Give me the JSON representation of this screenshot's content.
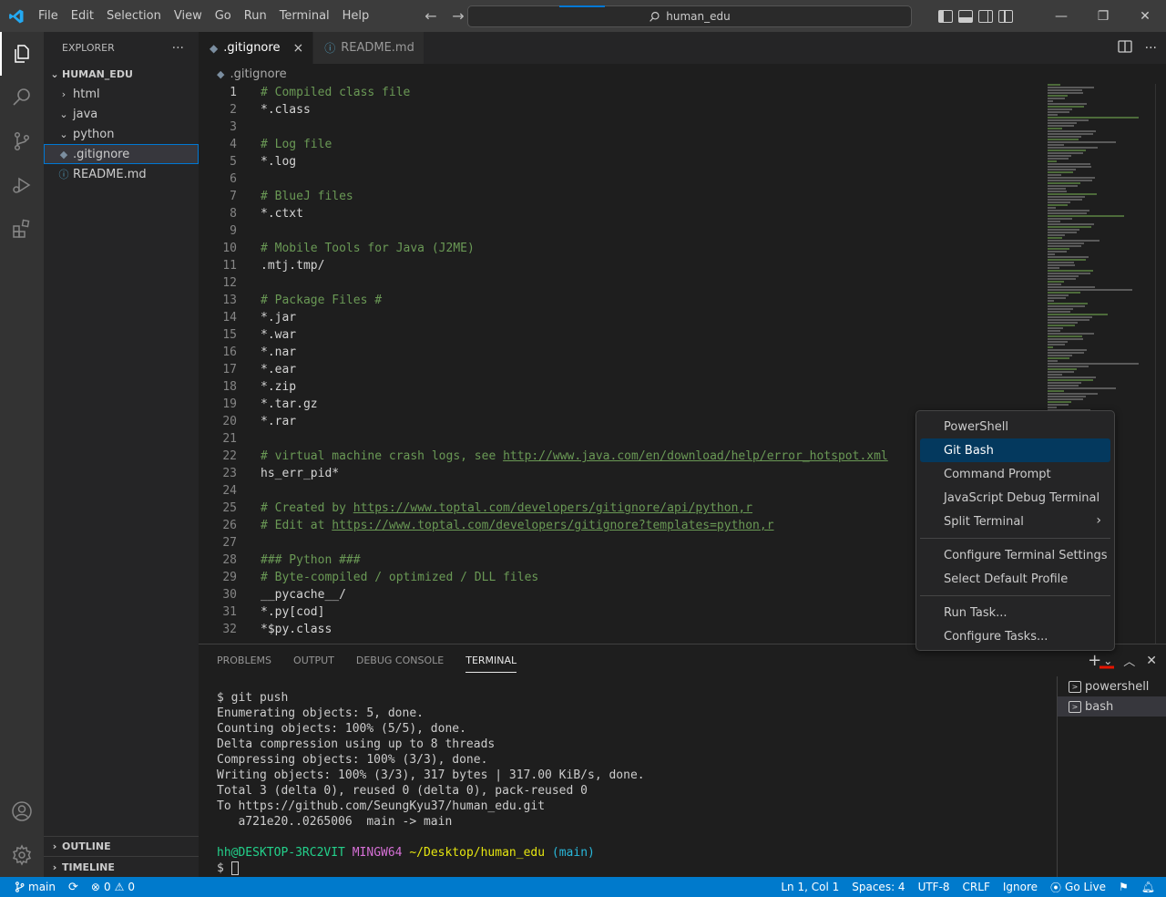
{
  "menu": [
    "File",
    "Edit",
    "Selection",
    "View",
    "Go",
    "Run",
    "Terminal",
    "Help"
  ],
  "command_center": {
    "label": "human_edu"
  },
  "sidebar": {
    "title": "EXPLORER",
    "more": "···",
    "root": "HUMAN_EDU",
    "items": [
      {
        "label": "html",
        "type": "folder",
        "expanded": false
      },
      {
        "label": "java",
        "type": "folder",
        "expanded": true
      },
      {
        "label": "python",
        "type": "folder",
        "expanded": true
      },
      {
        "label": ".gitignore",
        "type": "file",
        "selected": true
      },
      {
        "label": "README.md",
        "type": "file-info"
      }
    ],
    "outline": "OUTLINE",
    "timeline": "TIMELINE"
  },
  "tabs": [
    {
      "label": ".gitignore",
      "active": true,
      "close": "×"
    },
    {
      "label": "README.md",
      "active": false
    }
  ],
  "breadcrumb": ".gitignore",
  "code_lines": [
    {
      "n": "1",
      "text": "# Compiled class file",
      "kind": "comment"
    },
    {
      "n": "2",
      "text": "*.class",
      "kind": "plain"
    },
    {
      "n": "3",
      "text": "",
      "kind": "plain"
    },
    {
      "n": "4",
      "text": "# Log file",
      "kind": "comment"
    },
    {
      "n": "5",
      "text": "*.log",
      "kind": "plain"
    },
    {
      "n": "6",
      "text": "",
      "kind": "plain"
    },
    {
      "n": "7",
      "text": "# BlueJ files",
      "kind": "comment"
    },
    {
      "n": "8",
      "text": "*.ctxt",
      "kind": "plain"
    },
    {
      "n": "9",
      "text": "",
      "kind": "plain"
    },
    {
      "n": "10",
      "text": "# Mobile Tools for Java (J2ME)",
      "kind": "comment"
    },
    {
      "n": "11",
      "text": ".mtj.tmp/",
      "kind": "plain"
    },
    {
      "n": "12",
      "text": "",
      "kind": "plain"
    },
    {
      "n": "13",
      "text": "# Package Files #",
      "kind": "comment"
    },
    {
      "n": "14",
      "text": "*.jar",
      "kind": "plain"
    },
    {
      "n": "15",
      "text": "*.war",
      "kind": "plain"
    },
    {
      "n": "16",
      "text": "*.nar",
      "kind": "plain"
    },
    {
      "n": "17",
      "text": "*.ear",
      "kind": "plain"
    },
    {
      "n": "18",
      "text": "*.zip",
      "kind": "plain"
    },
    {
      "n": "19",
      "text": "*.tar.gz",
      "kind": "plain"
    },
    {
      "n": "20",
      "text": "*.rar",
      "kind": "plain"
    },
    {
      "n": "21",
      "text": "",
      "kind": "plain"
    },
    {
      "n": "22",
      "text": "# virtual machine crash logs, see ",
      "kind": "comment",
      "link": "http://www.java.com/en/download/help/error_hotspot.xml"
    },
    {
      "n": "23",
      "text": "hs_err_pid*",
      "kind": "plain"
    },
    {
      "n": "24",
      "text": "",
      "kind": "plain"
    },
    {
      "n": "25",
      "text": "# Created by ",
      "kind": "comment",
      "link": "https://www.toptal.com/developers/gitignore/api/python,r"
    },
    {
      "n": "26",
      "text": "# Edit at ",
      "kind": "comment",
      "link": "https://www.toptal.com/developers/gitignore?templates=python,r"
    },
    {
      "n": "27",
      "text": "",
      "kind": "plain"
    },
    {
      "n": "28",
      "text": "### Python ###",
      "kind": "comment"
    },
    {
      "n": "29",
      "text": "# Byte-compiled / optimized / DLL files",
      "kind": "comment"
    },
    {
      "n": "30",
      "text": "__pycache__/",
      "kind": "plain"
    },
    {
      "n": "31",
      "text": "*.py[cod]",
      "kind": "plain"
    },
    {
      "n": "32",
      "text": "*$py.class",
      "kind": "plain"
    }
  ],
  "panel": {
    "tabs": [
      "PROBLEMS",
      "OUTPUT",
      "DEBUG CONSOLE",
      "TERMINAL"
    ],
    "active_tab": "TERMINAL",
    "terminal_lines": [
      "$ git push",
      "Enumerating objects: 5, done.",
      "Counting objects: 100% (5/5), done.",
      "Delta compression using up to 8 threads",
      "Compressing objects: 100% (3/3), done.",
      "Writing objects: 100% (3/3), 317 bytes | 317.00 KiB/s, done.",
      "Total 3 (delta 0), reused 0 (delta 0), pack-reused 0",
      "To https://github.com/SeungKyu37/human_edu.git",
      "   a721e20..0265006  main -> main"
    ],
    "prompt": {
      "user": "hh@DESKTOP-3RC2VIT",
      "env": "MINGW64",
      "path": "~/Desktop/human_edu",
      "branch": "(main)",
      "symbol": "$"
    },
    "terminals": [
      {
        "label": "powershell",
        "active": false
      },
      {
        "label": "bash",
        "active": true
      }
    ]
  },
  "dropdown": {
    "groups": [
      [
        "PowerShell",
        "Git Bash",
        "Command Prompt",
        "JavaScript Debug Terminal",
        "Split Terminal"
      ],
      [
        "Configure Terminal Settings",
        "Select Default Profile"
      ],
      [
        "Run Task...",
        "Configure Tasks..."
      ]
    ],
    "highlighted": "Git Bash",
    "submenu_item": "Split Terminal"
  },
  "statusbar": {
    "branch": "main",
    "errors": "0",
    "warnings": "0",
    "position": "Ln 1, Col 1",
    "spaces": "Spaces: 4",
    "encoding": "UTF-8",
    "eol": "CRLF",
    "language": "Ignore",
    "golive": "Go Live"
  },
  "colors": {
    "accent": "#007acc",
    "highlight_underline": "#e51400"
  }
}
